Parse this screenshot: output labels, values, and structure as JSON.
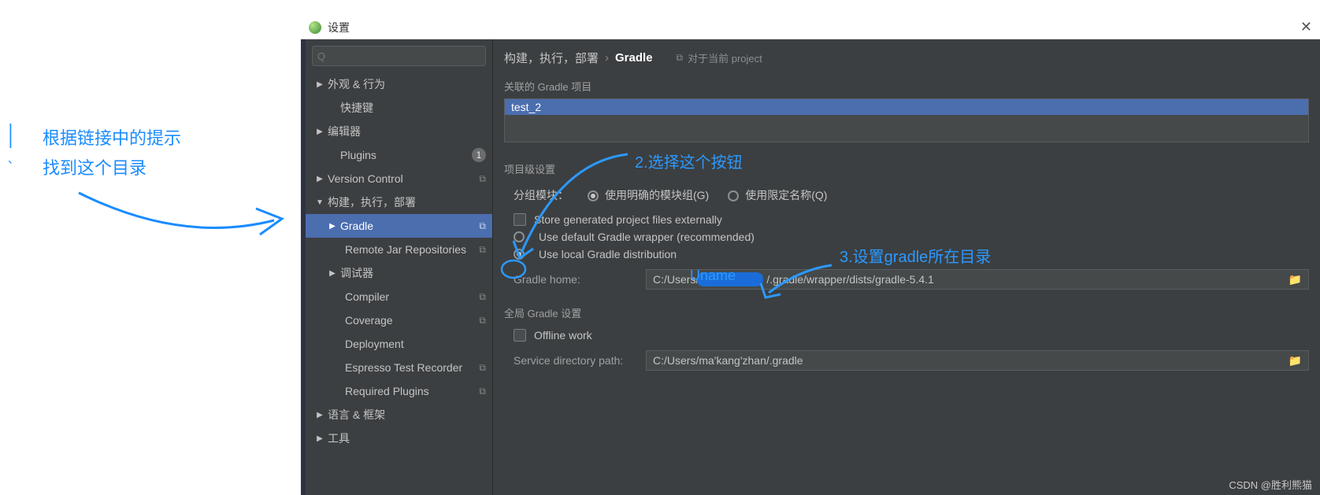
{
  "titlebar": {
    "title": "设置",
    "close": "✕"
  },
  "breadcrumb": {
    "root": "构建，执行，部署",
    "sep": "›",
    "leaf": "Gradle",
    "scope_icon": "⧉",
    "scope": "对于当前 project"
  },
  "search": {
    "placeholder": "Q"
  },
  "sidebar": {
    "node_appearance": "外观 & 行为",
    "node_keymap": "快捷键",
    "node_editor": "编辑器",
    "node_plugins": "Plugins",
    "plugins_badge": "1",
    "node_vcs": "Version Control",
    "node_build": "构建，执行，部署",
    "node_gradle": "Gradle",
    "node_remote_jar": "Remote Jar Repositories",
    "node_debugger": "调试器",
    "node_compiler": "Compiler",
    "node_coverage": "Coverage",
    "node_deployment": "Deployment",
    "node_espresso": "Espresso Test Recorder",
    "node_required_plugins": "Required Plugins",
    "node_lang": "语言 & 框架",
    "node_tools": "工具"
  },
  "content": {
    "linked_label": "关联的 Gradle 项目",
    "linked_item": "test_2",
    "project_settings_label": "项目级设置",
    "group_label": "分组模块：",
    "group_opt1": "使用明确的模块组(G)",
    "group_opt2": "使用限定名称(Q)",
    "store_externally": "Store generated project files externally",
    "use_default_wrapper": "Use default Gradle wrapper (recommended)",
    "use_local_dist": "Use local Gradle distribution",
    "gradle_home_label": "Gradle home:",
    "gradle_home_pre": "C:/Users/",
    "gradle_home_post": "/.gradle/wrapper/dists/gradle-5.4.1",
    "global_label": "全局 Gradle 设置",
    "offline_work": "Offline work",
    "service_dir_label": "Service directory path:",
    "service_dir_value": "C:/Users/ma'kang'zhan/.gradle"
  },
  "annotations": {
    "bar": "|",
    "a1_line1": "根据链接中的提示",
    "a1_line2": "找到这个目录",
    "a2": "2.选择这个按钮",
    "a3": "3.设置gradle所在目录",
    "uname": "Uname"
  },
  "watermark": "CSDN @胜利熊猫"
}
